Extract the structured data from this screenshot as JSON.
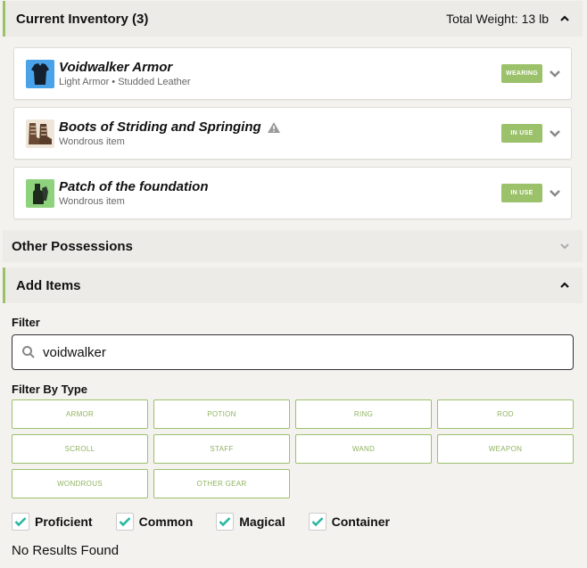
{
  "inventory": {
    "title": "Current Inventory (3)",
    "total_weight": "Total Weight: 13 lb",
    "items": [
      {
        "name": "Voidwalker Armor",
        "sub": "Light Armor • Studded Leather",
        "status": "WEARING",
        "icon": "armor-icon",
        "warning": false
      },
      {
        "name": "Boots of Striding and Springing",
        "sub": "Wondrous item",
        "status": "IN USE",
        "icon": "boots-icon",
        "warning": true
      },
      {
        "name": "Patch of the foundation",
        "sub": "Wondrous item",
        "status": "IN USE",
        "icon": "patch-icon",
        "warning": false
      }
    ]
  },
  "other": {
    "title": "Other Possessions"
  },
  "add": {
    "title": "Add Items",
    "filter_label": "Filter",
    "filter_value": "voidwalker",
    "filter_by_type_label": "Filter By Type",
    "types": [
      "ARMOR",
      "POTION",
      "RING",
      "ROD",
      "SCROLL",
      "STAFF",
      "WAND",
      "WEAPON",
      "WONDROUS",
      "OTHER GEAR"
    ],
    "checks": [
      {
        "label": "Proficient",
        "checked": true
      },
      {
        "label": "Common",
        "checked": true
      },
      {
        "label": "Magical",
        "checked": true
      },
      {
        "label": "Container",
        "checked": true
      }
    ],
    "no_results": "No Results Found"
  },
  "colors": {
    "accent": "#9bc16a",
    "header_bg": "#ecebe8",
    "armor_bg": "#4aa3e8",
    "patch_bg": "#8fd27d"
  }
}
